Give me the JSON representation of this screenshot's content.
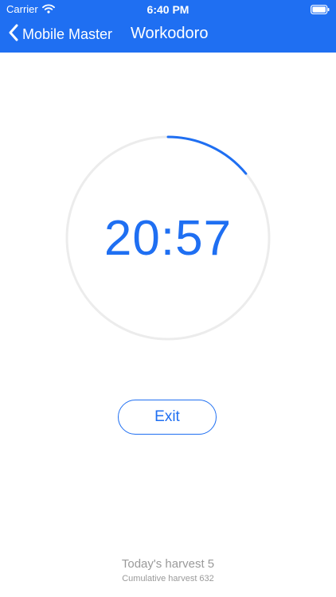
{
  "status_bar": {
    "carrier": "Carrier",
    "time": "6:40 PM"
  },
  "nav": {
    "back_label": "Mobile Master",
    "title": "Workodoro"
  },
  "timer": {
    "time": "20:57",
    "progress_fraction": 0.14
  },
  "controls": {
    "exit_label": "Exit"
  },
  "stats": {
    "today": "Today's harvest 5",
    "cumulative": "Cumulative harvest 632"
  },
  "colors": {
    "accent": "#1f6ff2",
    "ring_track": "#ececec",
    "muted_text": "#9a9a9a"
  },
  "icons": [
    "wifi-icon",
    "battery-icon",
    "chevron-left-icon"
  ]
}
